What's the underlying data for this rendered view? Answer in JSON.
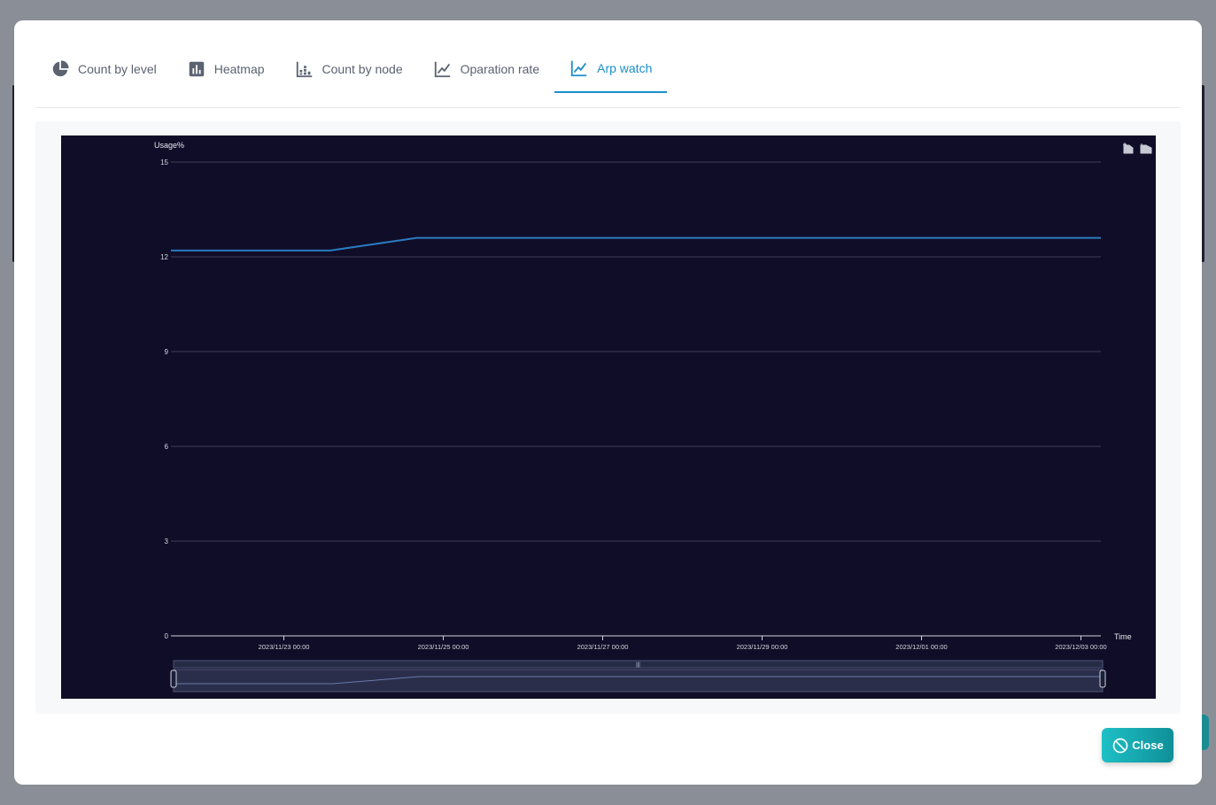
{
  "tabs": [
    {
      "label": "Count by level",
      "icon": "pie-chart-icon"
    },
    {
      "label": "Heatmap",
      "icon": "bar-chart-box-icon"
    },
    {
      "label": "Count by node",
      "icon": "stacked-bar-icon"
    },
    {
      "label": "Oparation rate",
      "icon": "line-chart-icon"
    },
    {
      "label": "Arp watch",
      "icon": "line-chart-icon"
    }
  ],
  "active_tab": 4,
  "colors": {
    "accent": "#1a8fc9",
    "chart_bg": "#100d28",
    "series": "#2a7bbf",
    "close_button": "#17a9b0"
  },
  "toolbox": {
    "zoom_icon": "zoom-icon",
    "restore_icon": "zoom-reset-icon"
  },
  "chart_data": {
    "type": "line",
    "ylabel": "Usage%",
    "xlabel": "Time",
    "ylim": [
      0,
      15
    ],
    "y_ticks": [
      "0",
      "3",
      "6",
      "9",
      "12",
      "15"
    ],
    "x_ticks": [
      "2023/11/23 00:00",
      "2023/11/25 00:00",
      "2023/11/27 00:00",
      "2023/11/29 00:00",
      "2023/12/01 00:00",
      "2023/12/03 00:00"
    ],
    "xlim": [
      "2023/11/21 14:00",
      "2023/12/03 06:00"
    ],
    "series": [
      {
        "values": [
          {
            "x": "2023/11/21 14:00",
            "y": 12.2
          },
          {
            "x": "2023/11/23 14:00",
            "y": 12.2
          },
          {
            "x": "2023/11/24 16:00",
            "y": 12.6
          },
          {
            "x": "2023/12/03 06:00",
            "y": 12.6
          }
        ]
      }
    ],
    "grid": true,
    "dataZoom": {
      "start": 0,
      "end": 100
    }
  },
  "close_button": {
    "label": "Close",
    "icon": "cancel-icon"
  }
}
